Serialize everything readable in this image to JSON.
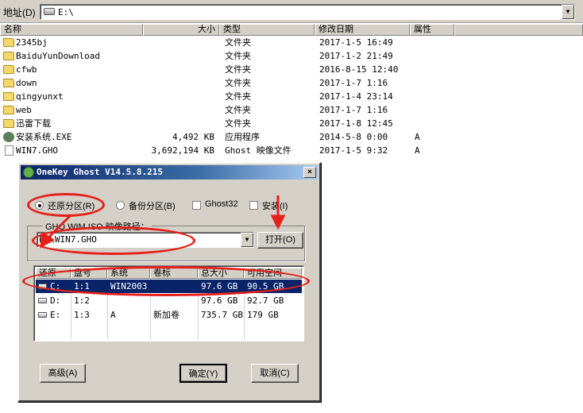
{
  "address_bar": {
    "label": "地址",
    "hotkey": "(D)",
    "value": "E:\\"
  },
  "columns": {
    "name": "名称",
    "size": "大小",
    "type": "类型",
    "modified": "修改日期",
    "attributes": "属性"
  },
  "files": [
    {
      "name": "2345bj",
      "size": "",
      "type": "文件夹",
      "date": "2017-1-5 16:49",
      "attr": "",
      "icon": "folder-icon"
    },
    {
      "name": "BaiduYunDownload",
      "size": "",
      "type": "文件夹",
      "date": "2017-1-2 21:49",
      "attr": "",
      "icon": "folder-icon"
    },
    {
      "name": "cfwb",
      "size": "",
      "type": "文件夹",
      "date": "2016-8-15 12:40",
      "attr": "",
      "icon": "folder-icon"
    },
    {
      "name": "down",
      "size": "",
      "type": "文件夹",
      "date": "2017-1-7 1:16",
      "attr": "",
      "icon": "folder-icon"
    },
    {
      "name": "qingyunxt",
      "size": "",
      "type": "文件夹",
      "date": "2017-1-4 23:14",
      "attr": "",
      "icon": "folder-icon"
    },
    {
      "name": "web",
      "size": "",
      "type": "文件夹",
      "date": "2017-1-7 1:16",
      "attr": "",
      "icon": "folder-icon"
    },
    {
      "name": "迅雷下载",
      "size": "",
      "type": "文件夹",
      "date": "2017-1-8 12:45",
      "attr": "",
      "icon": "folder-icon"
    },
    {
      "name": "安装系统.EXE",
      "size": "4,492 KB",
      "type": "应用程序",
      "date": "2014-5-8 0:00",
      "attr": "A",
      "icon": "exe-icon"
    },
    {
      "name": "WIN7.GHO",
      "size": "3,692,194 KB",
      "type": "Ghost 映像文件",
      "date": "2017-1-5 9:32",
      "attr": "A",
      "icon": "gho-file-icon"
    }
  ],
  "dialog": {
    "title": "OneKey Ghost V14.5.8.215",
    "close": "×",
    "options": {
      "restore": "还原分区",
      "restore_key": "(R)",
      "backup": "备份分区",
      "backup_key": "(B)",
      "ghost32": "Ghost32",
      "install": "安装",
      "install_key": "(I)"
    },
    "path_group_label": "GHO WIM ISO 映像路径：",
    "path_value": "E:\\WIN7.GHO",
    "open_button": "打开",
    "open_key": "(O)",
    "table_headers": [
      "还原",
      "盘号",
      "系统",
      "卷标",
      "总大小",
      "可用空间"
    ],
    "partitions": [
      {
        "drive": "C:",
        "num": "1:1",
        "system": "WIN2003",
        "label": "",
        "total": "97.6 GB",
        "free": "90.5 GB",
        "selected": true
      },
      {
        "drive": "D:",
        "num": "1:2",
        "system": "",
        "label": "",
        "total": "97.6 GB",
        "free": "92.7 GB",
        "selected": false
      },
      {
        "drive": "E:",
        "num": "1:3",
        "system": "A",
        "label": "新加卷",
        "total": "735.7 GB",
        "free": "179 GB",
        "selected": false
      }
    ],
    "advanced_button": "高级",
    "advanced_key": "(A)",
    "ok_button": "确定",
    "ok_key": "(Y)",
    "cancel_button": "取消",
    "cancel_key": "(C)"
  },
  "annotation_color": "#e5201a"
}
